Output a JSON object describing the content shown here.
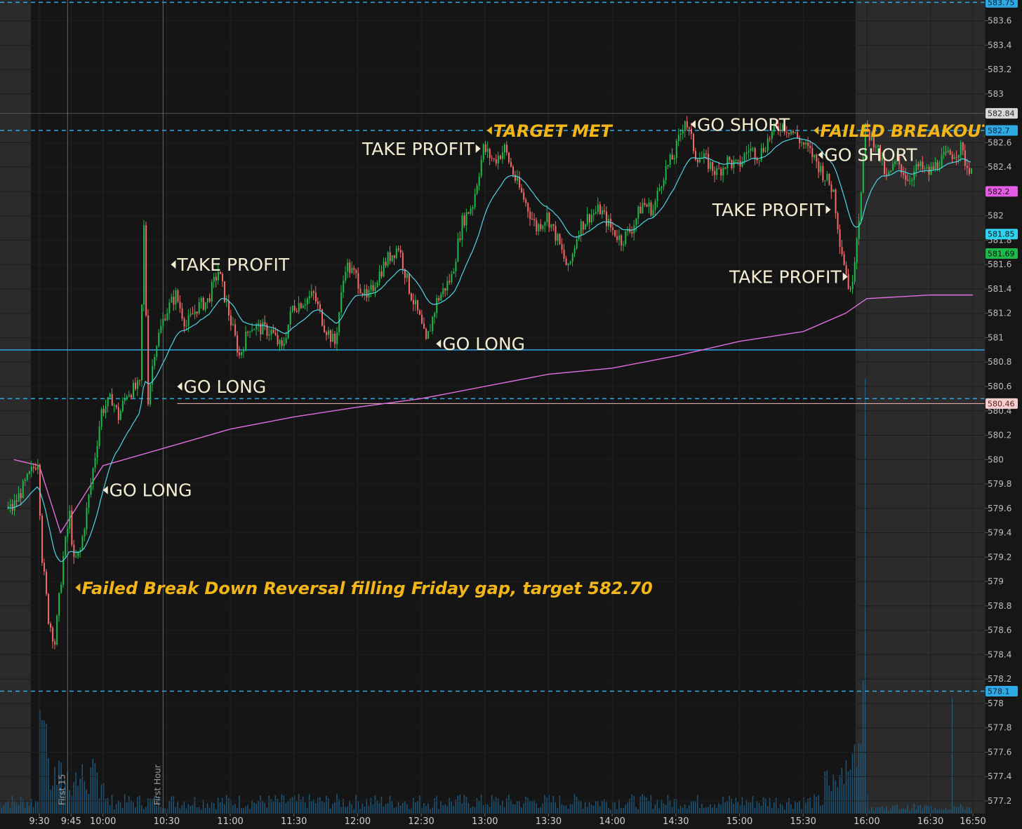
{
  "chart_data": {
    "type": "candlestick",
    "y_axis": {
      "ylim": [
        577.1,
        583.75
      ],
      "ticks": [
        577.2,
        577.4,
        577.6,
        577.8,
        578,
        578.2,
        578.4,
        578.6,
        578.8,
        579,
        579.2,
        579.4,
        579.6,
        579.8,
        580,
        580.2,
        580.4,
        580.6,
        580.8,
        581,
        581.2,
        581.4,
        581.6,
        581.8,
        582,
        582.2,
        582.4,
        582.6,
        583,
        583.2,
        583.4,
        583.6
      ],
      "tick_labels": [
        "577.2",
        "577.4",
        "577.6",
        "577.8",
        "578",
        "578.2",
        "578.4",
        "578.6",
        "578.8",
        "579",
        "579.2",
        "579.4",
        "579.6",
        "579.8",
        "580",
        "580.2",
        "580.4",
        "580.6",
        "580.8",
        "581",
        "581.2",
        "581.4",
        "581.6",
        "581.8",
        "582",
        "582.2",
        "582.4",
        "582.6",
        "583",
        "583.2",
        "583.4",
        "583.6"
      ]
    },
    "x_axis": {
      "tick_labels": [
        "9:30",
        "9:45",
        "10:00",
        "10:30",
        "11:00",
        "11:30",
        "12:00",
        "12:30",
        "13:00",
        "13:30",
        "14:00",
        "14:30",
        "15:00",
        "15:30",
        "16:00",
        "16:30",
        "16:50"
      ],
      "tick_minutes": [
        570,
        585,
        600,
        630,
        660,
        690,
        720,
        750,
        780,
        810,
        840,
        870,
        900,
        930,
        960,
        990,
        1010
      ]
    },
    "sessions": {
      "premarket_end": "9:30",
      "regular_close": "16:00"
    },
    "price_series": [
      {
        "t": "9:18",
        "p": 579.6
      },
      {
        "t": "9:30",
        "p": 580.0
      },
      {
        "t": "9:32",
        "p": 579.2
      },
      {
        "t": "9:35",
        "p": 578.7
      },
      {
        "t": "9:38",
        "p": 578.5
      },
      {
        "t": "9:42",
        "p": 579.2
      },
      {
        "t": "9:45",
        "p": 579.55
      },
      {
        "t": "9:47",
        "p": 579.15
      },
      {
        "t": "9:50",
        "p": 579.25
      },
      {
        "t": "9:55",
        "p": 579.8
      },
      {
        "t": "10:00",
        "p": 580.4
      },
      {
        "t": "10:05",
        "p": 580.5
      },
      {
        "t": "10:08",
        "p": 580.35
      },
      {
        "t": "10:12",
        "p": 580.55
      },
      {
        "t": "10:18",
        "p": 580.6
      },
      {
        "t": "10:20",
        "p": 581.9
      },
      {
        "t": "10:22",
        "p": 580.5
      },
      {
        "t": "10:25",
        "p": 580.9
      },
      {
        "t": "10:30",
        "p": 581.2
      },
      {
        "t": "10:35",
        "p": 581.35
      },
      {
        "t": "10:40",
        "p": 581.1
      },
      {
        "t": "10:45",
        "p": 581.25
      },
      {
        "t": "10:50",
        "p": 581.3
      },
      {
        "t": "10:55",
        "p": 581.55
      },
      {
        "t": "11:00",
        "p": 581.2
      },
      {
        "t": "11:05",
        "p": 580.85
      },
      {
        "t": "11:10",
        "p": 581.1
      },
      {
        "t": "11:20",
        "p": 581.05
      },
      {
        "t": "11:25",
        "p": 580.9
      },
      {
        "t": "11:30",
        "p": 581.25
      },
      {
        "t": "11:40",
        "p": 581.35
      },
      {
        "t": "11:45",
        "p": 581.1
      },
      {
        "t": "11:50",
        "p": 580.95
      },
      {
        "t": "11:55",
        "p": 581.6
      },
      {
        "t": "12:00",
        "p": 581.5
      },
      {
        "t": "12:05",
        "p": 581.3
      },
      {
        "t": "12:10",
        "p": 581.5
      },
      {
        "t": "12:15",
        "p": 581.65
      },
      {
        "t": "12:20",
        "p": 581.75
      },
      {
        "t": "12:25",
        "p": 581.4
      },
      {
        "t": "12:30",
        "p": 581.15
      },
      {
        "t": "12:33",
        "p": 580.95
      },
      {
        "t": "12:38",
        "p": 581.3
      },
      {
        "t": "12:45",
        "p": 581.5
      },
      {
        "t": "12:50",
        "p": 581.95
      },
      {
        "t": "12:55",
        "p": 582.1
      },
      {
        "t": "13:00",
        "p": 582.55
      },
      {
        "t": "13:05",
        "p": 582.45
      },
      {
        "t": "13:10",
        "p": 582.55
      },
      {
        "t": "13:15",
        "p": 582.3
      },
      {
        "t": "13:20",
        "p": 582.1
      },
      {
        "t": "13:25",
        "p": 581.9
      },
      {
        "t": "13:30",
        "p": 582.0
      },
      {
        "t": "13:35",
        "p": 581.8
      },
      {
        "t": "13:40",
        "p": 581.55
      },
      {
        "t": "13:45",
        "p": 581.9
      },
      {
        "t": "13:50",
        "p": 582.0
      },
      {
        "t": "13:55",
        "p": 582.05
      },
      {
        "t": "14:00",
        "p": 581.9
      },
      {
        "t": "14:05",
        "p": 581.8
      },
      {
        "t": "14:10",
        "p": 581.9
      },
      {
        "t": "14:15",
        "p": 582.1
      },
      {
        "t": "14:20",
        "p": 582.05
      },
      {
        "t": "14:25",
        "p": 582.35
      },
      {
        "t": "14:30",
        "p": 582.5
      },
      {
        "t": "14:35",
        "p": 582.8
      },
      {
        "t": "14:40",
        "p": 582.5
      },
      {
        "t": "14:45",
        "p": 582.45
      },
      {
        "t": "14:50",
        "p": 582.35
      },
      {
        "t": "14:55",
        "p": 582.45
      },
      {
        "t": "15:00",
        "p": 582.4
      },
      {
        "t": "15:05",
        "p": 582.55
      },
      {
        "t": "15:10",
        "p": 582.5
      },
      {
        "t": "15:15",
        "p": 582.65
      },
      {
        "t": "15:20",
        "p": 582.75
      },
      {
        "t": "15:25",
        "p": 582.7
      },
      {
        "t": "15:30",
        "p": 582.6
      },
      {
        "t": "15:35",
        "p": 582.5
      },
      {
        "t": "15:40",
        "p": 582.35
      },
      {
        "t": "15:45",
        "p": 582.2
      },
      {
        "t": "15:48",
        "p": 581.8
      },
      {
        "t": "15:53",
        "p": 581.35
      },
      {
        "t": "15:57",
        "p": 582.0
      },
      {
        "t": "16:00",
        "p": 582.7
      },
      {
        "t": "16:05",
        "p": 582.6
      },
      {
        "t": "16:10",
        "p": 582.3
      },
      {
        "t": "16:15",
        "p": 582.45
      },
      {
        "t": "16:20",
        "p": 582.3
      },
      {
        "t": "16:25",
        "p": 582.4
      },
      {
        "t": "16:30",
        "p": 582.35
      },
      {
        "t": "16:35",
        "p": 582.45
      },
      {
        "t": "16:40",
        "p": 582.5
      },
      {
        "t": "16:45",
        "p": 582.55
      },
      {
        "t": "16:48",
        "p": 582.4
      }
    ],
    "vwap": [
      {
        "t": "9:18",
        "p": 580.0
      },
      {
        "t": "9:30",
        "p": 579.95
      },
      {
        "t": "9:40",
        "p": 579.4
      },
      {
        "t": "10:00",
        "p": 579.95
      },
      {
        "t": "10:30",
        "p": 580.1
      },
      {
        "t": "11:00",
        "p": 580.25
      },
      {
        "t": "11:30",
        "p": 580.35
      },
      {
        "t": "12:00",
        "p": 580.43
      },
      {
        "t": "12:30",
        "p": 580.5
      },
      {
        "t": "13:00",
        "p": 580.6
      },
      {
        "t": "13:30",
        "p": 580.7
      },
      {
        "t": "14:00",
        "p": 580.75
      },
      {
        "t": "14:30",
        "p": 580.85
      },
      {
        "t": "15:00",
        "p": 580.97
      },
      {
        "t": "15:30",
        "p": 581.05
      },
      {
        "t": "15:50",
        "p": 581.2
      },
      {
        "t": "16:00",
        "p": 581.32
      },
      {
        "t": "16:30",
        "p": 581.35
      },
      {
        "t": "16:50",
        "p": 581.35
      }
    ],
    "levels": [
      {
        "price": 583.75,
        "style": "dashed",
        "color": "#2fa8e6",
        "label": "583.75"
      },
      {
        "price": 582.7,
        "style": "dashed",
        "color": "#2fa8e6",
        "label": "582.7"
      },
      {
        "price": 580.5,
        "style": "dashed",
        "color": "#2fa8e6",
        "label": ""
      },
      {
        "price": 578.1,
        "style": "dashed",
        "color": "#2fa8e6",
        "label": "578.1"
      },
      {
        "price": 580.9,
        "style": "solid",
        "color": "#2fa8e6",
        "label": ""
      },
      {
        "price": 580.46,
        "style": "solid",
        "color": "#f4b9b9",
        "label": "580.46"
      },
      {
        "price": 582.84,
        "style": "solid",
        "color": "#7a7a7a",
        "label": "582.84"
      }
    ],
    "price_labels": [
      {
        "price": 582.2,
        "label": "582.2",
        "color": "#e65ce6"
      },
      {
        "price": 581.85,
        "label": "581.85",
        "color": "#2ed3f0"
      },
      {
        "price": 581.69,
        "label": "581.69",
        "color": "#1fb84a"
      }
    ],
    "vertical_markers": [
      {
        "t": "9:45",
        "label": "First 15"
      },
      {
        "t": "10:30",
        "label": "First Hour"
      }
    ],
    "annotations": [
      {
        "text": "GO LONG",
        "t": "10:00",
        "p": 579.75,
        "arrow": "left",
        "style": "white"
      },
      {
        "text": "GO LONG",
        "t": "10:35",
        "p": 580.6,
        "arrow": "left",
        "style": "white"
      },
      {
        "text": "TAKE PROFIT",
        "t": "10:32",
        "p": 581.6,
        "arrow": "left",
        "style": "white"
      },
      {
        "text": "GO LONG",
        "t": "12:37",
        "p": 580.95,
        "arrow": "left",
        "style": "white"
      },
      {
        "text": "TAKE PROFIT",
        "t": "12:58",
        "p": 582.55,
        "arrow": "right",
        "style": "white"
      },
      {
        "text": "TARGET MET",
        "t": "13:01",
        "p": 582.7,
        "arrow": "left",
        "style": "yellow"
      },
      {
        "text": "GO SHORT",
        "t": "14:37",
        "p": 582.75,
        "arrow": "left",
        "style": "white"
      },
      {
        "text": "FAILED BREAKOUT",
        "t": "15:35",
        "p": 582.7,
        "arrow": "left",
        "style": "yellow"
      },
      {
        "text": "GO SHORT",
        "t": "15:37",
        "p": 582.5,
        "arrow": "left",
        "style": "white"
      },
      {
        "text": "TAKE PROFIT",
        "t": "15:43",
        "p": 582.05,
        "arrow": "right",
        "style": "white"
      },
      {
        "text": "TAKE PROFIT",
        "t": "15:51",
        "p": 581.5,
        "arrow": "right",
        "style": "white"
      },
      {
        "text": "Failed Break Down Reversal filling Friday gap, target 582.70",
        "t": "9:47",
        "p": 578.95,
        "arrow": "left",
        "style": "yellow"
      }
    ],
    "colors": {
      "up": "#1fb84a",
      "down": "#f26a6a",
      "ema": "#4fd4e6",
      "vwap": "#e26ee2",
      "volume": "#1e5a80",
      "background": "#151515",
      "shaded": "#2b2b2b"
    }
  }
}
